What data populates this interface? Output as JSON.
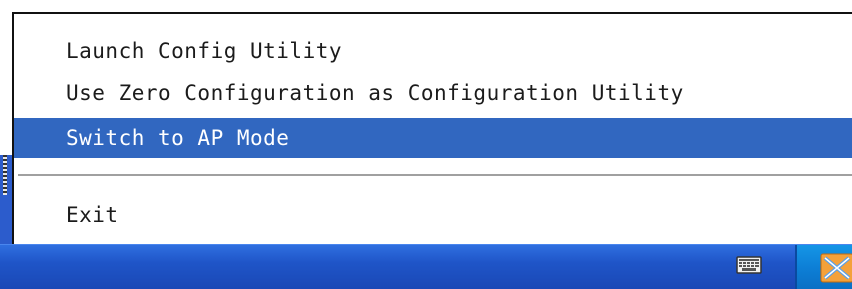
{
  "context_menu": {
    "items": [
      {
        "label": "Launch Config Utility",
        "highlighted": false
      },
      {
        "label": "Use Zero Configuration as Configuration Utility",
        "highlighted": false
      },
      {
        "label": "Switch to AP Mode",
        "highlighted": true
      },
      {
        "label": "Exit",
        "highlighted": false
      }
    ]
  },
  "taskbar": {
    "tray_icons": [
      "keyboard-icon",
      "wireless-utility-icon"
    ]
  },
  "colors": {
    "menu_background": "#ffffff",
    "highlight": "#3167c0",
    "taskbar": "#1f55c8",
    "tray": "#0d7fd6"
  }
}
